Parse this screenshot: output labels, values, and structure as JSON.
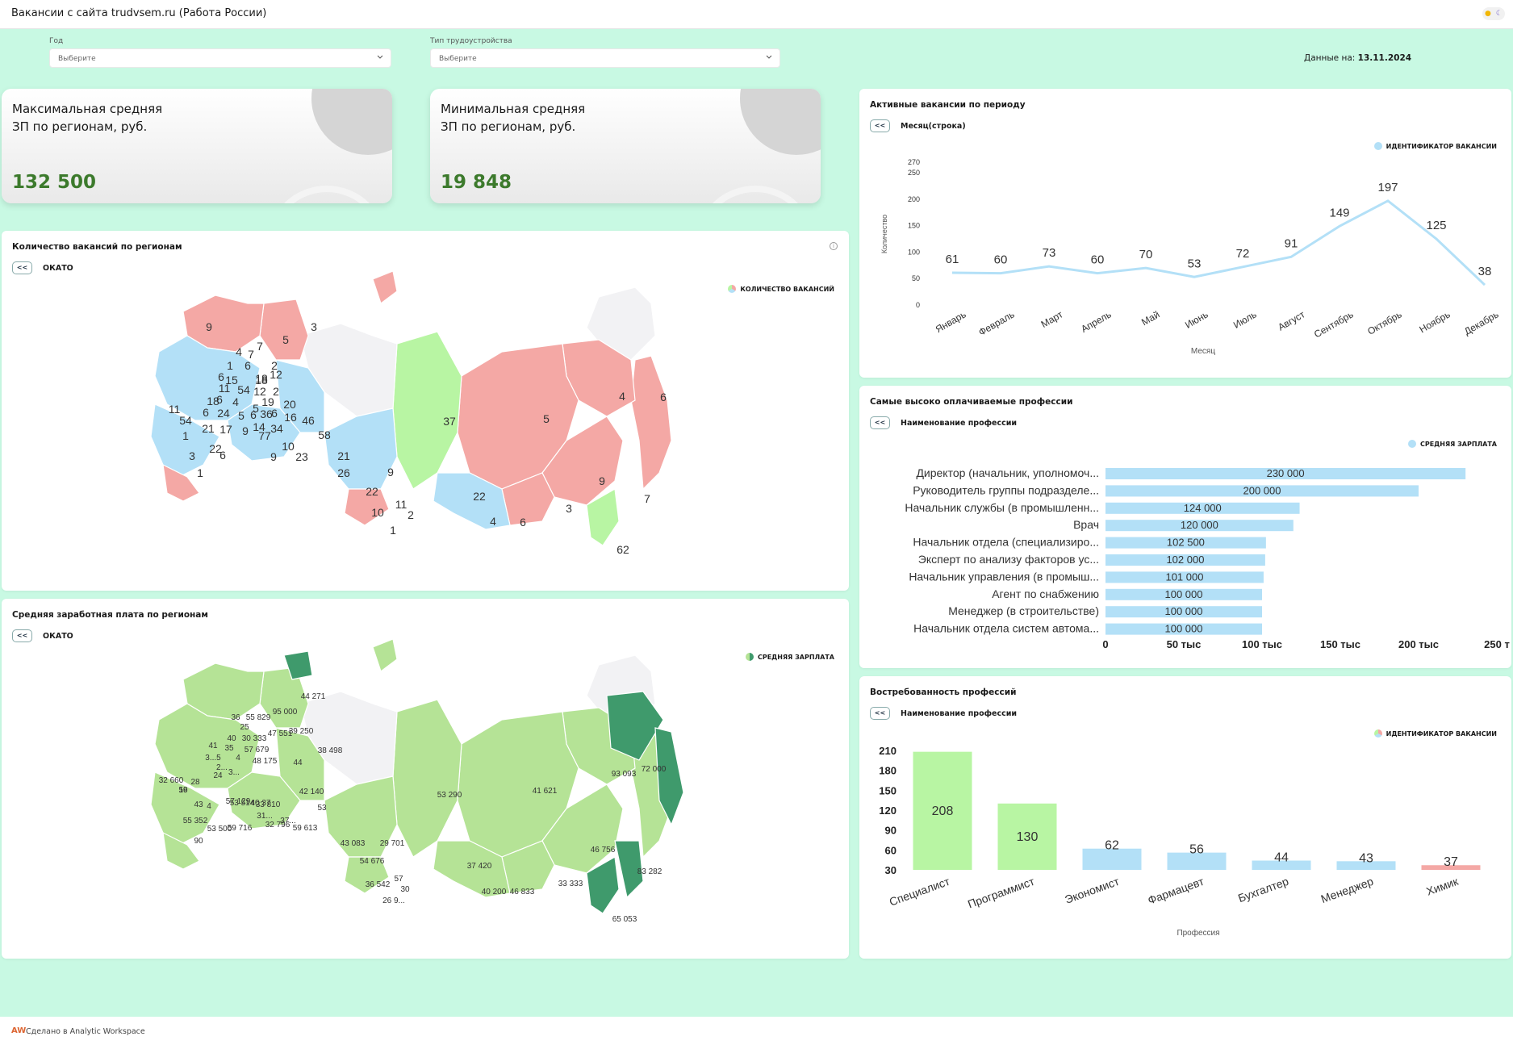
{
  "header": {
    "title": "Вакансии с сайта trudvsem.ru (Работа России)"
  },
  "filters": {
    "year": {
      "label": "Год",
      "placeholder": "Выберите"
    },
    "employment": {
      "label": "Тип трудоустройства",
      "placeholder": "Выберите"
    }
  },
  "date_info": {
    "label": "Данные на:",
    "value": "13.11.2024"
  },
  "kpi": {
    "max": {
      "label_line1": "Максимальная средняя",
      "label_line2": "ЗП по регионам, руб.",
      "value": "132 500"
    },
    "min": {
      "label_line1": "Минимальная средняя",
      "label_line2": "ЗП по регионам, руб.",
      "value": "19 848"
    }
  },
  "colors": {
    "bg": "#c8f9e3",
    "green_map": "#b5e396",
    "dark_green": "#3f9a6c",
    "blue": "#b3e0f7",
    "red": "#f4a8a5",
    "lightgreen": "#b8f5a3",
    "kpi_value": "#3c7a2c"
  },
  "vacancy_map": {
    "title": "Количество вакансий по регионам",
    "drill": "ОКАТО",
    "back": "<<",
    "legend": "КОЛИЧЕСТВО ВАКАНСИЙ",
    "labels": [
      "9",
      "3",
      "4",
      "7",
      "5",
      "7",
      "1",
      "6",
      "2",
      "6",
      "12",
      "15",
      "18",
      "11",
      "54",
      "12",
      "2",
      "18",
      "6",
      "19",
      "20",
      "11",
      "6",
      "4",
      "18",
      "5",
      "24",
      "6",
      "5",
      "36",
      "6",
      "16",
      "46",
      "54",
      "21",
      "17",
      "9",
      "14",
      "34",
      "58",
      "1",
      "77",
      "10",
      "22",
      "3",
      "6",
      "9",
      "23",
      "21",
      "26",
      "9",
      "1",
      "22",
      "11",
      "10",
      "2",
      "1",
      "37",
      "5",
      "4",
      "6",
      "22",
      "4",
      "6",
      "9",
      "3",
      "7",
      "62"
    ]
  },
  "salary_map": {
    "title": "Средняя заработная плата по регионам",
    "drill": "ОКАТО",
    "back": "<<",
    "legend": "СРЕДНЯЯ ЗАРПЛАТА",
    "labels": [
      "44 271",
      "95 000",
      "36",
      "55 829",
      "25",
      "40",
      "30 333",
      "47 551",
      "39 250",
      "41",
      "35",
      "57 679",
      "38 498",
      "3...5",
      "4",
      "48 175",
      "2...",
      "44",
      "32 660",
      "28",
      "24",
      "3...",
      "19",
      "42 140",
      "56",
      "43",
      "4",
      "57 129",
      "53 514",
      "40 37",
      "33 810",
      "53",
      "55 352",
      "37...",
      "53 500",
      "31...",
      "32 796",
      "59 716",
      "59 613",
      "90",
      "43 083",
      "29 701",
      "54 676",
      "53 290",
      "41 621",
      "93 093",
      "72 000",
      "57",
      "36 542",
      "30",
      "37 420",
      "40 200",
      "46 833",
      "33 333",
      "46 756",
      "83 282",
      "26 9...",
      "65 053"
    ]
  },
  "chart_data": [
    {
      "type": "line",
      "title": "Активные вакансии по периоду",
      "drill": "Месяц(строка)",
      "back": "<<",
      "legend": "ИДЕНТИФИКАТОР ВАКАНСИИ",
      "xlabel": "Месяц",
      "ylabel": "Количество",
      "ylim": [
        0,
        270
      ],
      "yticks": [
        "0",
        "50",
        "100",
        "150",
        "200",
        "250",
        "270"
      ],
      "categories": [
        "Январь",
        "Февраль",
        "Март",
        "Апрель",
        "Май",
        "Июнь",
        "Июль",
        "Август",
        "Сентябрь",
        "Октябрь",
        "Ноябрь",
        "Декабрь"
      ],
      "series": [
        {
          "values": [
            61,
            60,
            73,
            60,
            70,
            53,
            72,
            91,
            149,
            197,
            125,
            38
          ]
        }
      ]
    },
    {
      "type": "bar",
      "orientation": "horizontal",
      "title": "Самые высоко оплачиваемые профессии",
      "drill": "Наименование профессии",
      "back": "<<",
      "legend": "СРЕДНЯЯ ЗАРПЛАТА",
      "categories": [
        "Директор (начальник, уполномоч...",
        "Руководитель группы подразделе...",
        "Начальник службы (в промышленн...",
        "Врач",
        "Начальник отдела (специализиро...",
        "Эксперт по анализу факторов ус...",
        "Начальник управления (в промыш...",
        "Агент по снабжению",
        "Менеджер (в строительстве)",
        "Начальник отдела систем автома..."
      ],
      "values": [
        230000,
        200000,
        124000,
        120000,
        102500,
        102000,
        101000,
        100000,
        100000,
        100000
      ],
      "value_labels": [
        "230 000",
        "200 000",
        "124 000",
        "120 000",
        "102 500",
        "102 000",
        "101 000",
        "100 000",
        "100 000",
        "100 000"
      ],
      "xlim": [
        0,
        250000
      ],
      "xticks": [
        "0",
        "50 тыс",
        "100 тыс",
        "150 тыс",
        "200 тыс",
        "250 т"
      ]
    },
    {
      "type": "bar",
      "title": "Востребованность профессий",
      "drill": "Наименование профессии",
      "back": "<<",
      "legend": "ИДЕНТИФИКАТОР ВАКАНСИИ",
      "xlabel": "Профессия",
      "ylim": [
        30,
        210
      ],
      "yticks": [
        "30",
        "60",
        "90",
        "120",
        "150",
        "180",
        "210"
      ],
      "categories": [
        "Специалист",
        "Программист",
        "Экономист",
        "Фармацевт",
        "Бухгалтер",
        "Менеджер",
        "Химик"
      ],
      "values": [
        208,
        130,
        62,
        56,
        44,
        43,
        37
      ],
      "bar_colors": [
        "#b8f5a3",
        "#b8f5a3",
        "#b3e0f7",
        "#b3e0f7",
        "#b3e0f7",
        "#b3e0f7",
        "#f4a8a5"
      ]
    }
  ],
  "footer": {
    "logo": "AW",
    "text": "Сделано в Analytic Workspace"
  }
}
